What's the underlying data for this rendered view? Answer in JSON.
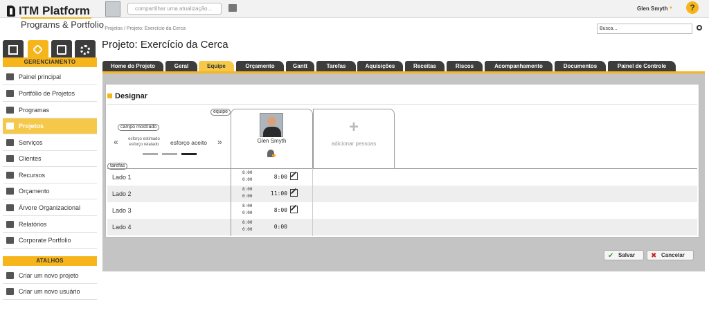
{
  "brand": {
    "name": "ITM Platform",
    "subtitle": "Programs & Portfolio"
  },
  "topbar": {
    "share_placeholder": "compartilhar uma atualização...",
    "user_name": "Glen Smyth",
    "help": "?"
  },
  "sidebar": {
    "section_title": "GERENCIAMENTO",
    "items": [
      {
        "label": "Painel principal",
        "icon": "dashboard-icon"
      },
      {
        "label": "Portfólio de Projetos",
        "icon": "briefcase-icon"
      },
      {
        "label": "Programas",
        "icon": "programs-icon"
      },
      {
        "label": "Projetos",
        "icon": "projects-icon",
        "active": true
      },
      {
        "label": "Serviços",
        "icon": "services-icon"
      },
      {
        "label": "Clientes",
        "icon": "clients-icon"
      },
      {
        "label": "Recursos",
        "icon": "resources-icon"
      },
      {
        "label": "Orçamento",
        "icon": "budget-icon"
      },
      {
        "label": "Árvore Organizacional",
        "icon": "org-tree-icon"
      },
      {
        "label": "Relatórios",
        "icon": "reports-icon"
      },
      {
        "label": "Corporate Portfolio",
        "icon": "portfolio-icon"
      }
    ],
    "shortcuts_title": "ATALHOS",
    "shortcuts": [
      {
        "label": "Criar um novo projeto",
        "icon": "new-project-icon"
      },
      {
        "label": "Criar um novo usuário",
        "icon": "new-user-icon"
      }
    ]
  },
  "breadcrumb": {
    "path": "Projetos / Projeto: Exercício da Cerca"
  },
  "search": {
    "placeholder": "Busca..."
  },
  "page": {
    "title": "Projeto: Exercício da Cerca"
  },
  "tabs": [
    {
      "label": "Home do Projeto"
    },
    {
      "label": "Geral"
    },
    {
      "label": "Equipe",
      "active": true
    },
    {
      "label": "Orçamento"
    },
    {
      "label": "Gantt"
    },
    {
      "label": "Tarefas"
    },
    {
      "label": "Aquisições"
    },
    {
      "label": "Receitas"
    },
    {
      "label": "Riscos"
    },
    {
      "label": "Acompanhamento"
    },
    {
      "label": "Documentos"
    },
    {
      "label": "Painel de Controle"
    }
  ],
  "assign": {
    "heading": "Designar",
    "field_shown_label": "campo mostrado",
    "effort_estimated": "esforço estimado",
    "effort_reported": "esforço relatado",
    "effort_accepted": "esforço aceito",
    "team_label": "equipe",
    "tasks_label": "tarefas",
    "member_name": "Glen Smyth",
    "add_people": "adicionar pessoas",
    "plus": "+",
    "chevron_left": "«",
    "chevron_right": "»",
    "rows": [
      {
        "task": "Lado 1",
        "est": "8:00",
        "rep": "0:00",
        "value": "8:00",
        "editable": true
      },
      {
        "task": "Lado 2",
        "est": "8:00",
        "rep": "0:00",
        "value": "11:00",
        "editable": true
      },
      {
        "task": "Lado 3",
        "est": "8:00",
        "rep": "0:00",
        "value": "8:00",
        "editable": true
      },
      {
        "task": "Lado 4",
        "est": "8:00",
        "rep": "0:00",
        "value": "0:00",
        "editable": false
      }
    ]
  },
  "actions": {
    "save": "Salvar",
    "cancel": "Cancelar"
  },
  "colors": {
    "accent": "#f6b51a",
    "tab_dark": "#3d3d3d",
    "save_icon": "#3a9a3a",
    "cancel_icon": "#cc2222"
  }
}
